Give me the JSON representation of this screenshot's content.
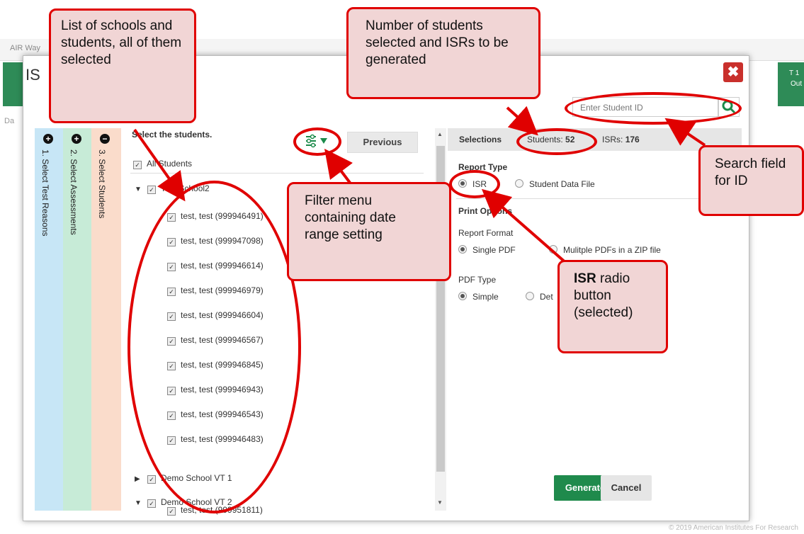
{
  "background": {
    "app_title": "AIR Way",
    "right_tab_line1": "T 1",
    "right_tab_line2": "Out",
    "left_char": "Da",
    "copyright": "© 2019 American Institutes For Research"
  },
  "modal": {
    "title": "IS",
    "close_label": "✖",
    "search_placeholder": "Enter Student ID"
  },
  "steps": [
    {
      "label": "1. Select Test Reasons",
      "icon": "+"
    },
    {
      "label": "2. Select Assessments",
      "icon": "+"
    },
    {
      "label": "3. Select Students",
      "icon": "−"
    }
  ],
  "student_list": {
    "heading": "Select the students.",
    "previous_label": "Previous",
    "all_students_label": "All Students",
    "school1": "Test School2",
    "students": [
      "test, test (999946491)",
      "test, test (999947098)",
      "test, test (999946614)",
      "test, test (999946979)",
      "test, test (999946604)",
      "test, test (999946567)",
      "test, test (999946845)",
      "test, test (999946943)",
      "test, test (999946543)",
      "test, test (999946483)"
    ],
    "school2": "Demo School VT 1",
    "school3": "Demo School VT 2",
    "school3_student": "test, test (999951811)"
  },
  "selections": {
    "title": "Selections",
    "students_label": "Students:",
    "students_count": "52",
    "isrs_label": "ISRs:",
    "isrs_count": "176",
    "report_type_title": "Report Type",
    "report_isr": "ISR",
    "report_sdf": "Student Data File",
    "print_options_title": "Print Options",
    "report_format_title": "Report Format",
    "format_single": "Single PDF",
    "format_multi": "Mulitple PDFs in a ZIP file",
    "pdf_type_title": "PDF Type",
    "pdf_simple": "Simple",
    "pdf_detailed": "Det",
    "generate_label": "Generate",
    "cancel_label": "Cancel"
  },
  "callouts": {
    "list": "List of schools and students, all of them selected",
    "number": "Number of students selected and ISRs to be generated",
    "search": "Search field for ID",
    "filter": "Filter menu containing date range setting",
    "isr_bold": "ISR",
    "isr_rest": " radio button (selected)"
  },
  "colors": {
    "annotation_red": "#e00000",
    "callout_fill": "#f1d5d5",
    "generate_green": "#1f8a4c",
    "close_red": "#c9302c"
  }
}
